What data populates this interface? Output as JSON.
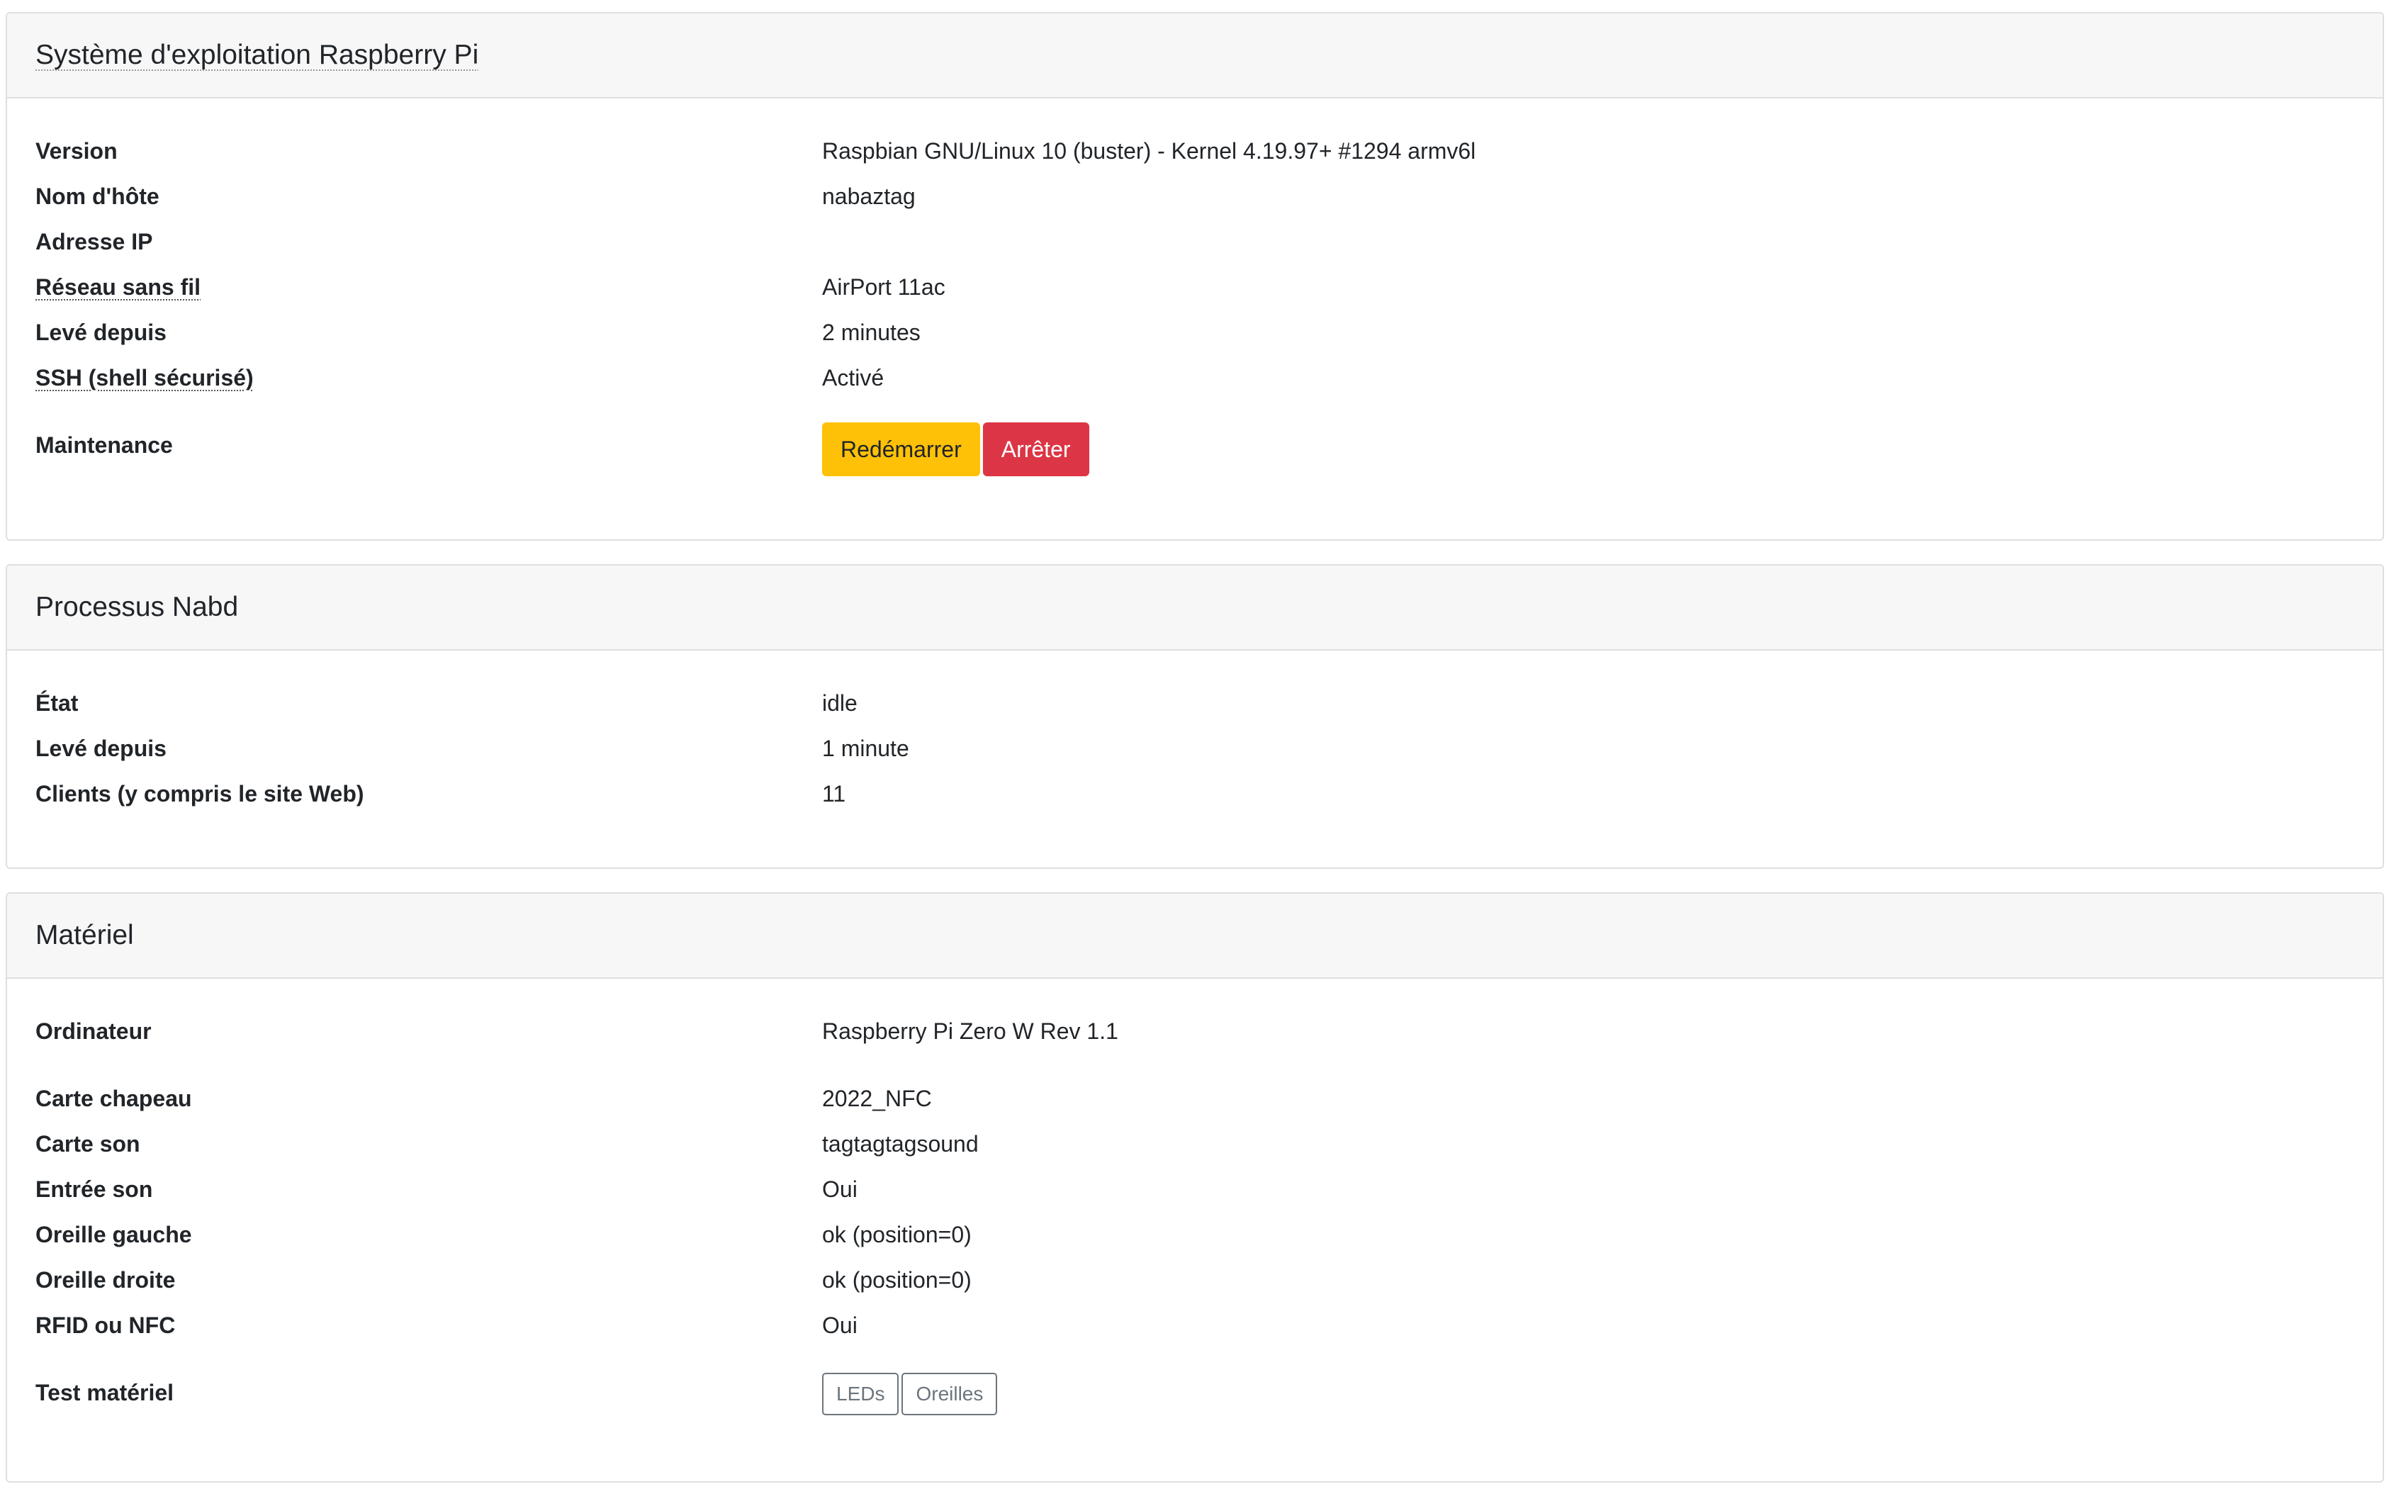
{
  "os": {
    "title": "Système d'exploitation Raspberry Pi",
    "rows": [
      {
        "label": "Version",
        "value": "Raspbian GNU/Linux 10 (buster) - Kernel 4.19.97+ #1294 armv6l"
      },
      {
        "label": "Nom d'hôte",
        "value": "nabaztag"
      },
      {
        "label": "Adresse IP",
        "value": ""
      },
      {
        "label": "Réseau sans fil",
        "value": "AirPort 11ac"
      },
      {
        "label": "Levé depuis",
        "value": "2 minutes"
      },
      {
        "label": "SSH (shell sécurisé)",
        "value": "Activé"
      }
    ],
    "maintenance": {
      "label": "Maintenance",
      "restart_label": "Redémarrer",
      "shutdown_label": "Arrêter"
    }
  },
  "nabd": {
    "title": "Processus Nabd",
    "rows": [
      {
        "label": "État",
        "value": "idle"
      },
      {
        "label": "Levé depuis",
        "value": "1 minute"
      },
      {
        "label": "Clients (y compris le site Web)",
        "value": "11"
      }
    ]
  },
  "hardware": {
    "title": "Matériel",
    "computer": {
      "label": "Ordinateur",
      "value": "Raspberry Pi Zero W Rev 1.1"
    },
    "rows": [
      {
        "label": "Carte chapeau",
        "value": "2022_NFC"
      },
      {
        "label": "Carte son",
        "value": "tagtagtagsound"
      },
      {
        "label": "Entrée son",
        "value": "Oui"
      },
      {
        "label": "Oreille gauche",
        "value": "ok (position=0)"
      },
      {
        "label": "Oreille droite",
        "value": "ok (position=0)"
      },
      {
        "label": "RFID ou NFC",
        "value": "Oui"
      }
    ],
    "test": {
      "label": "Test matériel",
      "leds_label": "LEDs",
      "ears_label": "Oreilles"
    }
  },
  "colors": {
    "warning": "#ffc107",
    "danger": "#dc3545",
    "header_bg": "#f7f7f7",
    "border": "#dfdfdf"
  }
}
